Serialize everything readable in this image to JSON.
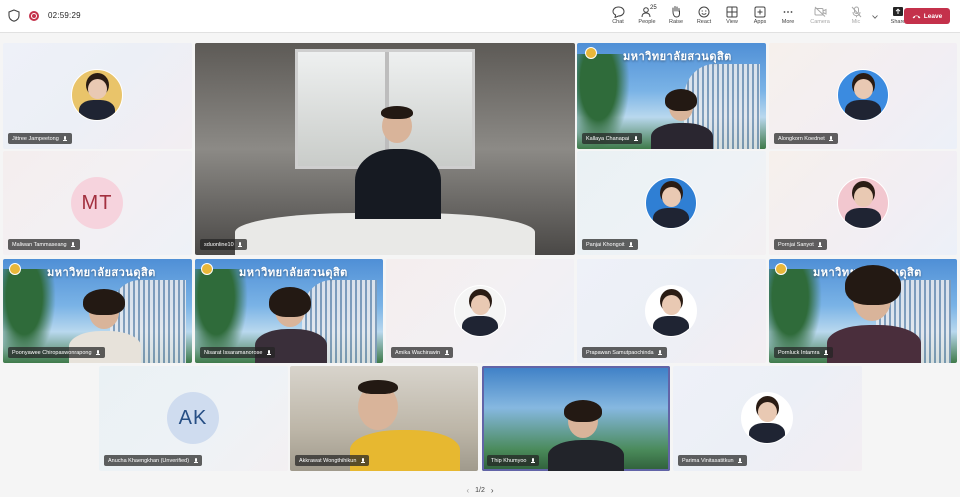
{
  "header": {
    "timer": "02:59:29",
    "people_count": "25",
    "tools": [
      {
        "key": "chat",
        "label": "Chat",
        "icon": "chat-icon",
        "disabled": false
      },
      {
        "key": "people",
        "label": "People",
        "icon": "people-icon",
        "disabled": false
      },
      {
        "key": "raise",
        "label": "Raise",
        "icon": "raise-hand-icon",
        "disabled": false
      },
      {
        "key": "react",
        "label": "React",
        "icon": "react-smiley-icon",
        "disabled": false
      },
      {
        "key": "view",
        "label": "View",
        "icon": "view-grid-icon",
        "disabled": false
      },
      {
        "key": "apps",
        "label": "Apps",
        "icon": "apps-plus-icon",
        "disabled": false
      },
      {
        "key": "more",
        "label": "More",
        "icon": "more-ellipsis-icon",
        "disabled": false
      },
      {
        "key": "camera",
        "label": "Camera",
        "icon": "camera-off-icon",
        "disabled": true
      },
      {
        "key": "mic",
        "label": "Mic",
        "icon": "mic-off-icon",
        "disabled": true
      },
      {
        "key": "share",
        "label": "Share",
        "icon": "share-up-icon",
        "disabled": false
      }
    ],
    "leave_label": "Leave",
    "leave_color": "#c4314b",
    "accent_color": "#6264a7"
  },
  "participants": [
    {
      "name": "Jittree Jampeetong",
      "kind": "photo"
    },
    {
      "name": "sduonline10",
      "kind": "video"
    },
    {
      "name": "Kallaya Chanapai",
      "kind": "video"
    },
    {
      "name": "Alongkorn Koednet",
      "kind": "photo"
    },
    {
      "name": "Maliwan Tammaseang",
      "kind": "initials",
      "initials": "MT"
    },
    {
      "name": "Panjai Khongoit",
      "kind": "photo"
    },
    {
      "name": "Pornjai Sanyot",
      "kind": "photo"
    },
    {
      "name": "Poonyawee Chiropaswonrapong",
      "kind": "video"
    },
    {
      "name": "Nisarat Issaramanorose",
      "kind": "video"
    },
    {
      "name": "Amika Wachirawin",
      "kind": "photo"
    },
    {
      "name": "Prapawan Samutpaochinda",
      "kind": "photo"
    },
    {
      "name": "Pornluck Intamra",
      "kind": "video"
    },
    {
      "name": "Anucha Khaengkhan (Unverified)",
      "kind": "initials",
      "initials": "AK"
    },
    {
      "name": "Akkrawat Wongthihikun",
      "kind": "video"
    },
    {
      "name": "Thip Khumyoo",
      "kind": "video"
    },
    {
      "name": "Parima Vinitasatitkun",
      "kind": "photo"
    }
  ],
  "banner_text": "มหาวิทยาลัยสวนดุสิต",
  "pager": {
    "label": "1/2",
    "prev_icon": "chevron-left-icon",
    "next_icon": "chevron-right-icon"
  }
}
